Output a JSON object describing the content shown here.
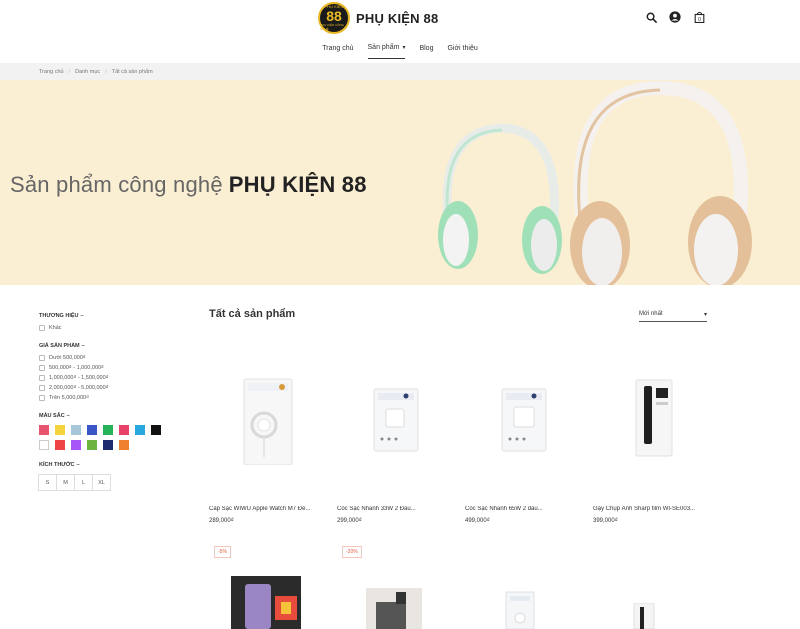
{
  "header": {
    "logo_top": "PHỤ KIỆN",
    "logo_number": "88",
    "logo_bottom": "PHỤ KIỆN CÔNG NGHỆ",
    "logo_text": "PHỤ KIỆN 88",
    "icons": [
      "search-icon",
      "user-icon",
      "cart-icon"
    ],
    "cart_count": "0"
  },
  "nav": {
    "items": [
      {
        "label": "Trang chủ"
      },
      {
        "label": "Sản phẩm"
      },
      {
        "label": "Blog"
      },
      {
        "label": "Giới thiệu"
      }
    ]
  },
  "breadcrumb": [
    "Trang chủ",
    "Danh mục",
    "Tất cả sản phẩm"
  ],
  "hero": {
    "text": "Sản phẩm công nghệ",
    "brand": "PHỤ KIỆN 88"
  },
  "sidebar": {
    "brand_title": "THƯƠNG HIỆU",
    "brand_options": [
      "Khác"
    ],
    "price_title": "GIÁ SẢN PHẨM",
    "price_options": [
      "Dưới 500,000₫",
      "500,000₫ - 1,000,000₫",
      "1,000,000₫ - 1,500,000₫",
      "2,000,000₫ - 5,000,000₫",
      "Trên 5,000,000₫"
    ],
    "color_title": "MÀU SẮC",
    "colors": [
      "#e8536d",
      "#f5d33a",
      "#a7c7d8",
      "#3a55c5",
      "#27b35a",
      "#e8416a",
      "#29a8e0",
      "#111111",
      "#ffffff",
      "#ef4444",
      "#a855f7",
      "#6cb33f",
      "#1e2b6e",
      "#f0802e"
    ],
    "size_title": "KÍCH THƯỚC",
    "sizes": [
      "S",
      "M",
      "L",
      "XL"
    ],
    "dash": "–"
  },
  "main": {
    "title": "Tất cả sản phẩm",
    "sort_label": "Mới nhất"
  },
  "products": [
    {
      "name": "Cáp Sạc WIWU Apple Watch M7 Đế...",
      "price": "289,000₫"
    },
    {
      "name": "Cóc Sạc Nhanh 33W 2 Đầu...",
      "price": "299,000₫"
    },
    {
      "name": "Cóc Sạc Nhanh 65W 2 đầu...",
      "price": "499,000₫"
    },
    {
      "name": "Gậy Chụp Ảnh Sharp film WI-SE003...",
      "price": "399,000₫"
    }
  ],
  "discounts": [
    "-5%",
    "-20%"
  ]
}
